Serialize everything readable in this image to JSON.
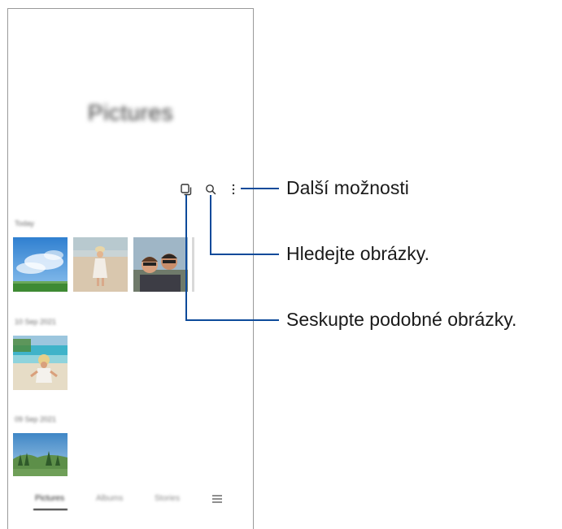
{
  "screen": {
    "title": "Pictures",
    "sections": [
      {
        "label": "Today"
      },
      {
        "label": "10 Sep 2021"
      },
      {
        "label": "09 Sep 2021"
      }
    ],
    "bottom_nav": {
      "tabs": [
        "Pictures",
        "Albums",
        "Stories"
      ],
      "menu_icon": "hamburger-menu-icon"
    },
    "toolbar": {
      "icons": [
        "group-similar-icon",
        "search-icon",
        "more-options-icon"
      ]
    }
  },
  "callouts": {
    "more_options": "Další možnosti",
    "search": "Hledejte obrázky.",
    "group_similar": "Seskupte podobné obrázky."
  },
  "colors": {
    "callout_line": "#0d4a9a",
    "frame_border": "#9a9a9a"
  }
}
